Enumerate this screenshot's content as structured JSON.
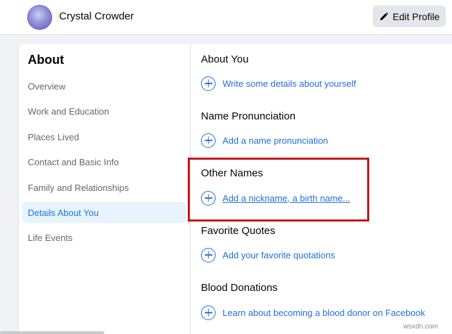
{
  "header": {
    "profile_name": "Crystal Crowder",
    "edit_button_label": "Edit Profile"
  },
  "sidebar": {
    "title": "About",
    "items": [
      {
        "label": "Overview"
      },
      {
        "label": "Work and Education"
      },
      {
        "label": "Places Lived"
      },
      {
        "label": "Contact and Basic Info"
      },
      {
        "label": "Family and Relationships"
      },
      {
        "label": "Details About You",
        "active": true
      },
      {
        "label": "Life Events"
      }
    ]
  },
  "sections": [
    {
      "title": "About You",
      "link": "Write some details about yourself"
    },
    {
      "title": "Name Pronunciation",
      "link": "Add a name pronunciation"
    },
    {
      "title": "Other Names",
      "link": "Add a nickname, a birth name..."
    },
    {
      "title": "Favorite Quotes",
      "link": "Add your favorite quotations"
    },
    {
      "title": "Blood Donations",
      "link": "Learn about becoming a blood donor on Facebook"
    }
  ],
  "watermark": "wsxdn.com",
  "colors": {
    "accent": "#216fdb",
    "active_bg": "#e7f3ff",
    "highlight": "#c4161c"
  }
}
